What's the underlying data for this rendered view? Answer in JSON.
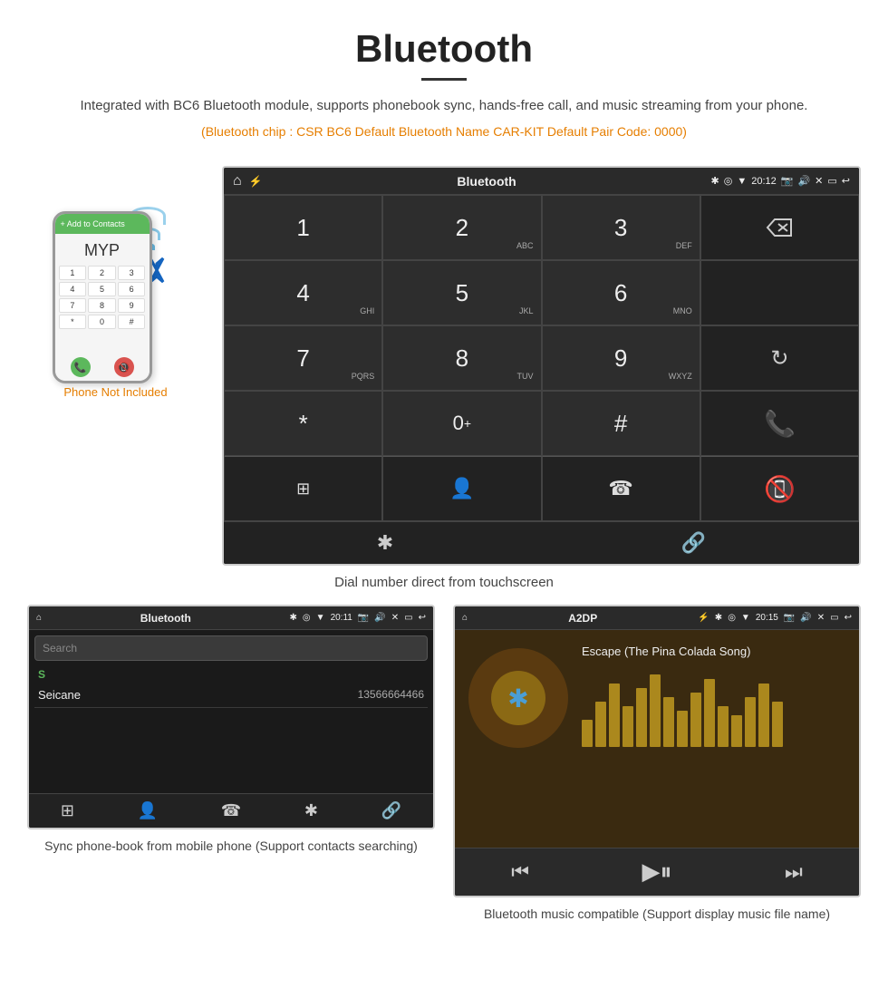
{
  "header": {
    "title": "Bluetooth",
    "description": "Integrated with BC6 Bluetooth module, supports phonebook sync, hands-free call, and music streaming from your phone.",
    "specs": "(Bluetooth chip : CSR BC6    Default Bluetooth Name CAR-KIT    Default Pair Code: 0000)"
  },
  "phone_note": "Phone Not Included",
  "head_unit": {
    "status_bar_title": "Bluetooth",
    "time": "20:12",
    "dial_keys": [
      {
        "label": "1",
        "sub": ""
      },
      {
        "label": "2",
        "sub": "ABC"
      },
      {
        "label": "3",
        "sub": "DEF"
      },
      {
        "label": "⌫",
        "sub": ""
      },
      {
        "label": "4",
        "sub": "GHI"
      },
      {
        "label": "5",
        "sub": "JKL"
      },
      {
        "label": "6",
        "sub": "MNO"
      },
      {
        "label": "",
        "sub": ""
      },
      {
        "label": "7",
        "sub": "PQRS"
      },
      {
        "label": "8",
        "sub": "TUV"
      },
      {
        "label": "9",
        "sub": "WXYZ"
      },
      {
        "label": "↺",
        "sub": ""
      },
      {
        "label": "*",
        "sub": ""
      },
      {
        "label": "0⁺",
        "sub": ""
      },
      {
        "label": "#",
        "sub": ""
      },
      {
        "label": "☎",
        "sub": ""
      },
      {
        "label": "🔴",
        "sub": ""
      }
    ]
  },
  "dial_caption": "Dial number direct from touchscreen",
  "phonebook": {
    "status_title": "Bluetooth",
    "time": "20:11",
    "search_placeholder": "Search",
    "section_label": "S",
    "contact_name": "Seicane",
    "contact_number": "13566664466"
  },
  "phonebook_caption": "Sync phone-book from mobile phone\n(Support contacts searching)",
  "music": {
    "status_title": "A2DP",
    "time": "20:15",
    "track_name": "Escape (The Pina Colada Song)",
    "eq_heights": [
      30,
      50,
      70,
      45,
      65,
      80,
      55,
      40,
      60,
      75,
      45,
      35,
      55,
      70,
      50
    ]
  },
  "music_caption": "Bluetooth music compatible\n(Support display music file name)"
}
